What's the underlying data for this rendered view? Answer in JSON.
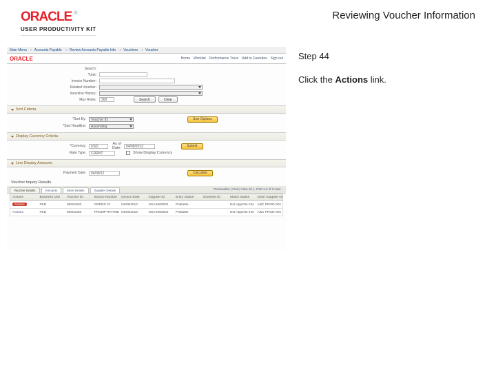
{
  "header": {
    "brand": "ORACLE",
    "tm": "®",
    "upk": "USER PRODUCTIVITY KIT",
    "title": "Reviewing Voucher Information"
  },
  "side": {
    "step": "Step 44",
    "instr_pre": "Click the ",
    "instr_bold": "Actions",
    "instr_post": " link."
  },
  "shot": {
    "nav": [
      "Main Menu",
      "Accounts Payable",
      "Review Accounts Payable Info",
      "Vouchers",
      "Voucher"
    ],
    "brand_links": [
      "Home",
      "Worklist",
      "Performance Trace",
      "Add to Favorites",
      "Sign out"
    ],
    "form": {
      "search": "Search:",
      "unit": "*Unit:",
      "invoice": "Invoice Number:",
      "related": "Related Voucher:",
      "incentive": "Incentive History:",
      "max": "Max Rows:",
      "max_val": "300",
      "search_btn": "Search",
      "clear_btn": "Clear"
    },
    "sec1": {
      "title": "Sort Criteria",
      "sort_by": "*Sort By:",
      "sort_val": "Voucher ID",
      "sort_headline": "*Sort Headline:",
      "sort_head_val": "Ascending",
      "sort_opt": "Sort Options"
    },
    "sec2": {
      "title": "Display Currency Criteria",
      "cur": "*Currency:",
      "cur_val": "USD",
      "date": "As of Date:",
      "date_val": "04/09/2012",
      "submit": "Submit",
      "rate": "Rate Type:",
      "rate_val": "CRRNT",
      "show": "Show Display Currency"
    },
    "sec3": {
      "title": "Line Display Amounts",
      "pay": "Payment Date:",
      "pay_val": "04/09/12",
      "calc": "Calculate"
    },
    "results": {
      "title": "Voucher Inquiry Results",
      "tabs": [
        "Voucher Details",
        "Amounts",
        "More Details",
        "Supplier Details"
      ],
      "pager": "Personalize | Find | View All | ◦ First 1-2 of 2 Last",
      "cols": [
        "Actions",
        "Business Unit",
        "Voucher ID",
        "Invoice Number",
        "Invoice Date",
        "Supplier ID",
        "Entry Status",
        "Incentive ID",
        "Match Status",
        "Short Supplier Name"
      ],
      "rows": [
        {
          "act": "Actions",
          "bu": "FED",
          "vid": "00001002",
          "inv": "ORDER #1",
          "idate": "04/09/2012",
          "sup": "USAS000001",
          "est": "Postable",
          "iid": "",
          "ms": "Not Appl/No Info",
          "ssn": "ABC PROD-001"
        },
        {
          "act": "Actions",
          "bu": "FED",
          "vid": "00001003",
          "inv": "PROMPTPAYMENT",
          "idate": "04/09/2012",
          "sup": "USAS000001",
          "est": "Postable",
          "iid": "",
          "ms": "Not Appl/No Info",
          "ssn": "ABC PROD-001"
        }
      ]
    }
  }
}
